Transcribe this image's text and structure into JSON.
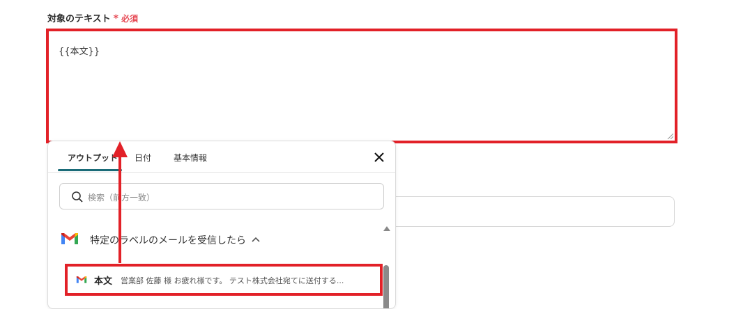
{
  "field": {
    "label": "対象のテキスト",
    "required_star": "*",
    "required_text": "必須",
    "value": "{{本文}}"
  },
  "panel": {
    "tabs": [
      {
        "label": "アウトプット",
        "active": true
      },
      {
        "label": "日付",
        "active": false
      },
      {
        "label": "基本情報",
        "active": false
      }
    ],
    "search_placeholder": "検索（前方一致）",
    "group": {
      "title": "特定のラベルのメールを受信したら",
      "icon": "gmail-icon"
    },
    "items": [
      {
        "label": "本文",
        "value": "営業部 佐藤 様 お疲れ様です。 テスト株式会社宛てに送付する..."
      }
    ]
  },
  "colors": {
    "highlight": "#e22128",
    "tab_accent": "#1a6b78",
    "required": "#e64a55"
  }
}
